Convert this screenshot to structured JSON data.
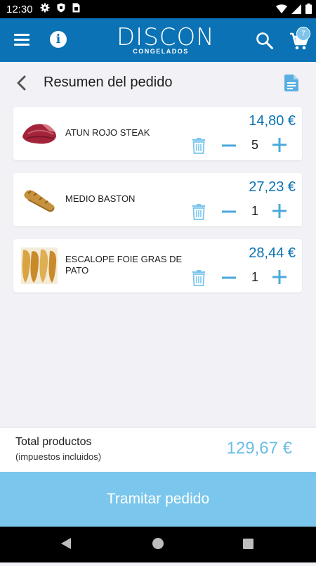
{
  "status_bar": {
    "time": "12:30"
  },
  "app_bar": {
    "brand_word": "DISCON",
    "brand_sub": "CONGELADOS",
    "cart_count": "7"
  },
  "page": {
    "title": "Resumen del pedido"
  },
  "order_items": [
    {
      "name": "ATUN ROJO STEAK",
      "price": "14,80 €",
      "quantity": "5"
    },
    {
      "name": "MEDIO BASTON",
      "price": "27,23 €",
      "quantity": "1"
    },
    {
      "name": "ESCALOPE FOIE GRAS DE PATO",
      "price": "28,44 €",
      "quantity": "1"
    }
  ],
  "summary": {
    "label": "Total productos",
    "sublabel": "(impuestos incluidos)",
    "total": "129,67 €"
  },
  "checkout": {
    "label": "Tramitar pedido"
  },
  "colors": {
    "brand": "#0a72b5",
    "accent": "#6cbce6",
    "button": "#7ac6ec"
  }
}
